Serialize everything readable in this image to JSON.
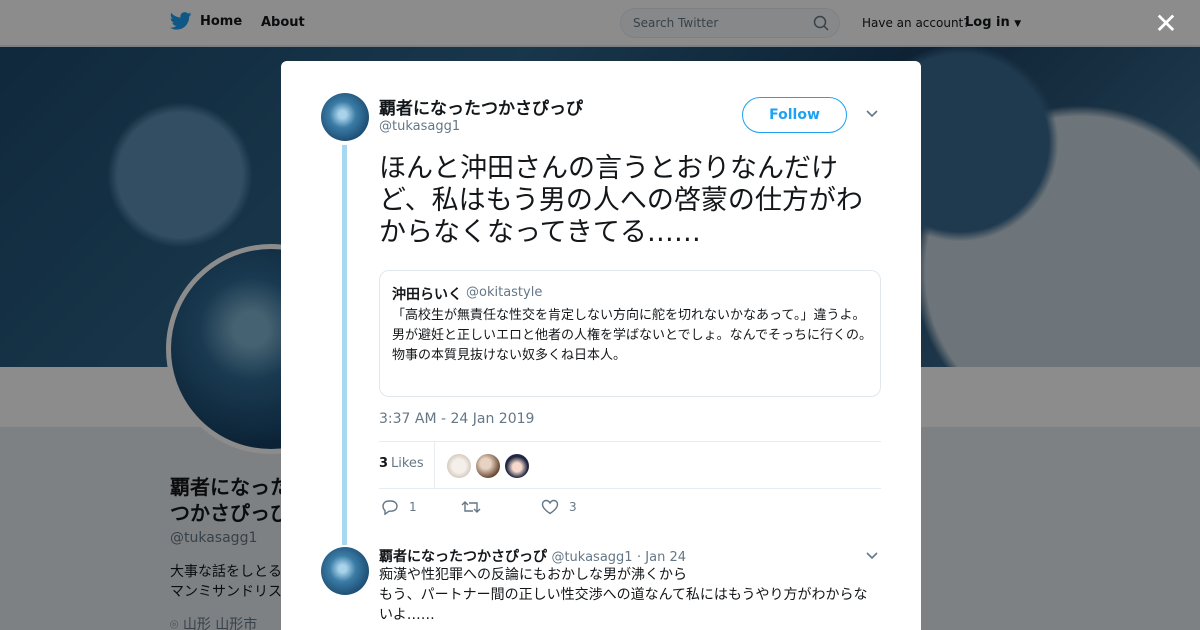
{
  "nav": {
    "home_label": "Home",
    "about_label": "About",
    "search_placeholder": "Search Twitter",
    "have_account": "Have an account?",
    "login_label": "Log in"
  },
  "profile": {
    "name": "覇者になったつかさぴっぴ",
    "handle": "@tukasagg1",
    "bio": "大事な話をしとる…\nマンミサンドリス…",
    "location": "山形 山形市"
  },
  "tweet": {
    "author_name": "覇者になったつかさぴっぴ",
    "author_handle": "@tukasagg1",
    "follow_label": "Follow",
    "text": "ほんと沖田さんの言うとおりなんだけど、私はもう男の人への啓蒙の仕方がわからなくなってきてる……",
    "quote": {
      "name": "沖田らいく",
      "handle": "@okitastyle",
      "text": "「高校生が無責任な性交を肯定しない方向に舵を切れないかなあって。」違うよ。男が避妊と正しいエロと他者の人権を学ばないとでしょ。なんでそっちに行くの。物事の本質見抜けない奴多くね日本人。"
    },
    "timestamp": "3:37 AM - 24 Jan 2019",
    "likes_count": "3",
    "likes_label": "Likes",
    "reply_count": "1",
    "retweet_count": "",
    "like_action_count": "3"
  },
  "reply": {
    "name": "覇者になったつかさぴっぴ",
    "handle": "@tukasagg1",
    "date": "· Jan 24",
    "text": "痴漢や性犯罪への反論にもおかしな男が沸くから\nもう、パートナー間の正しい性交渉への道なんて私にはもうやり方がわからないよ……"
  },
  "colors": {
    "accent": "#1da1f2",
    "thread": "#a6d8f0",
    "muted": "#657786"
  }
}
